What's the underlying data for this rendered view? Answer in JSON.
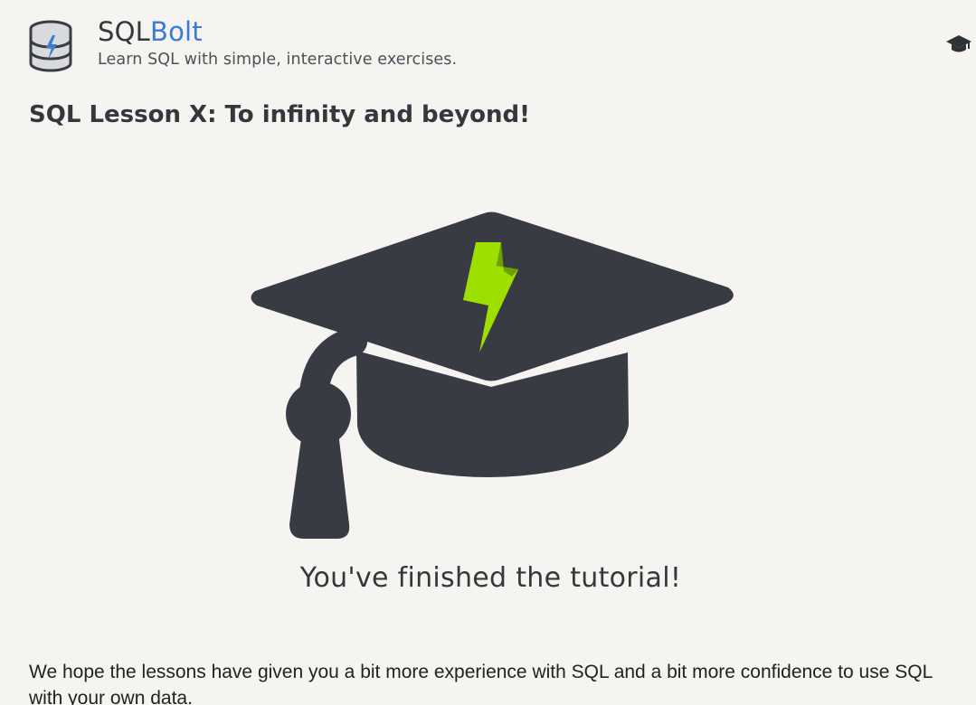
{
  "header": {
    "brand_prefix": "SQL",
    "brand_accent": "Bolt",
    "tagline": "Learn SQL with simple, interactive exercises.",
    "logo_icon": "database-bolt-icon",
    "nav_icon": "graduation-cap-icon"
  },
  "main": {
    "lesson_title": "SQL Lesson X: To infinity and beyond!",
    "illustration_icon": "graduation-cap-bolt-icon",
    "finish_message": "You've finished the tutorial!",
    "closing_text": "We hope the lessons have given you a bit more experience with SQL and a bit more confidence to use SQL with your own data."
  },
  "colors": {
    "background": "#f5f4f0",
    "text": "#35373d",
    "brand_accent": "#3a7bd5",
    "cap": "#383b44",
    "bolt": "#9de000"
  }
}
